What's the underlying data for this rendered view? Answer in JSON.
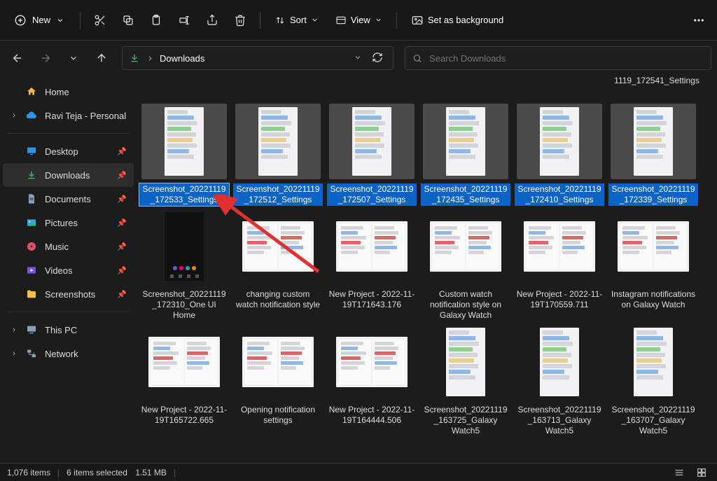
{
  "toolbar": {
    "new_label": "New",
    "sort_label": "Sort",
    "view_label": "View",
    "background_label": "Set as background"
  },
  "addressbar": {
    "crumb": "Downloads"
  },
  "search": {
    "placeholder": "Search Downloads"
  },
  "sidebar": {
    "home": "Home",
    "personal": "Ravi Teja - Personal",
    "desktop": "Desktop",
    "downloads": "Downloads",
    "documents": "Documents",
    "pictures": "Pictures",
    "music": "Music",
    "videos": "Videos",
    "screenshots": "Screenshots",
    "thispc": "This PC",
    "network": "Network"
  },
  "partial_top_label": "1119_172541_Settings",
  "files": [
    {
      "name": "Screenshot_20221119_172533_Settings",
      "thumb": "phone",
      "selected": true,
      "rename": true
    },
    {
      "name": "Screenshot_20221119_172512_Settings",
      "thumb": "phone",
      "selected": true
    },
    {
      "name": "Screenshot_20221119_172507_Settings",
      "thumb": "phone",
      "selected": true
    },
    {
      "name": "Screenshot_20221119_172435_Settings",
      "thumb": "phone",
      "selected": true
    },
    {
      "name": "Screenshot_20221119_172410_Settings",
      "thumb": "phone",
      "selected": true
    },
    {
      "name": "Screenshot_20221119_172339_Settings",
      "thumb": "phone",
      "selected": true
    },
    {
      "name": "Screenshot_20221119_172310_One UI Home",
      "thumb": "dark"
    },
    {
      "name": "changing custom watch notification style",
      "thumb": "wide"
    },
    {
      "name": "New Project - 2022-11-19T171643.176",
      "thumb": "wide"
    },
    {
      "name": "Custom watch notification style on Galaxy Watch",
      "thumb": "wide"
    },
    {
      "name": "New Project - 2022-11-19T170559.711",
      "thumb": "wide"
    },
    {
      "name": "Instagram notifications on Galaxy Watch",
      "thumb": "wide"
    },
    {
      "name": "New Project - 2022-11-19T165722.665",
      "thumb": "wide"
    },
    {
      "name": "Opening notification settings",
      "thumb": "wide"
    },
    {
      "name": "New Project - 2022-11-19T164444.506",
      "thumb": "wide"
    },
    {
      "name": "Screenshot_20221119_163725_Galaxy Watch5",
      "thumb": "phone"
    },
    {
      "name": "Screenshot_20221119_163713_Galaxy Watch5",
      "thumb": "phone"
    },
    {
      "name": "Screenshot_20221119_163707_Galaxy Watch5",
      "thumb": "phone"
    }
  ],
  "status": {
    "items": "1,076 items",
    "selected": "6 items selected",
    "size": "1.51 MB"
  }
}
